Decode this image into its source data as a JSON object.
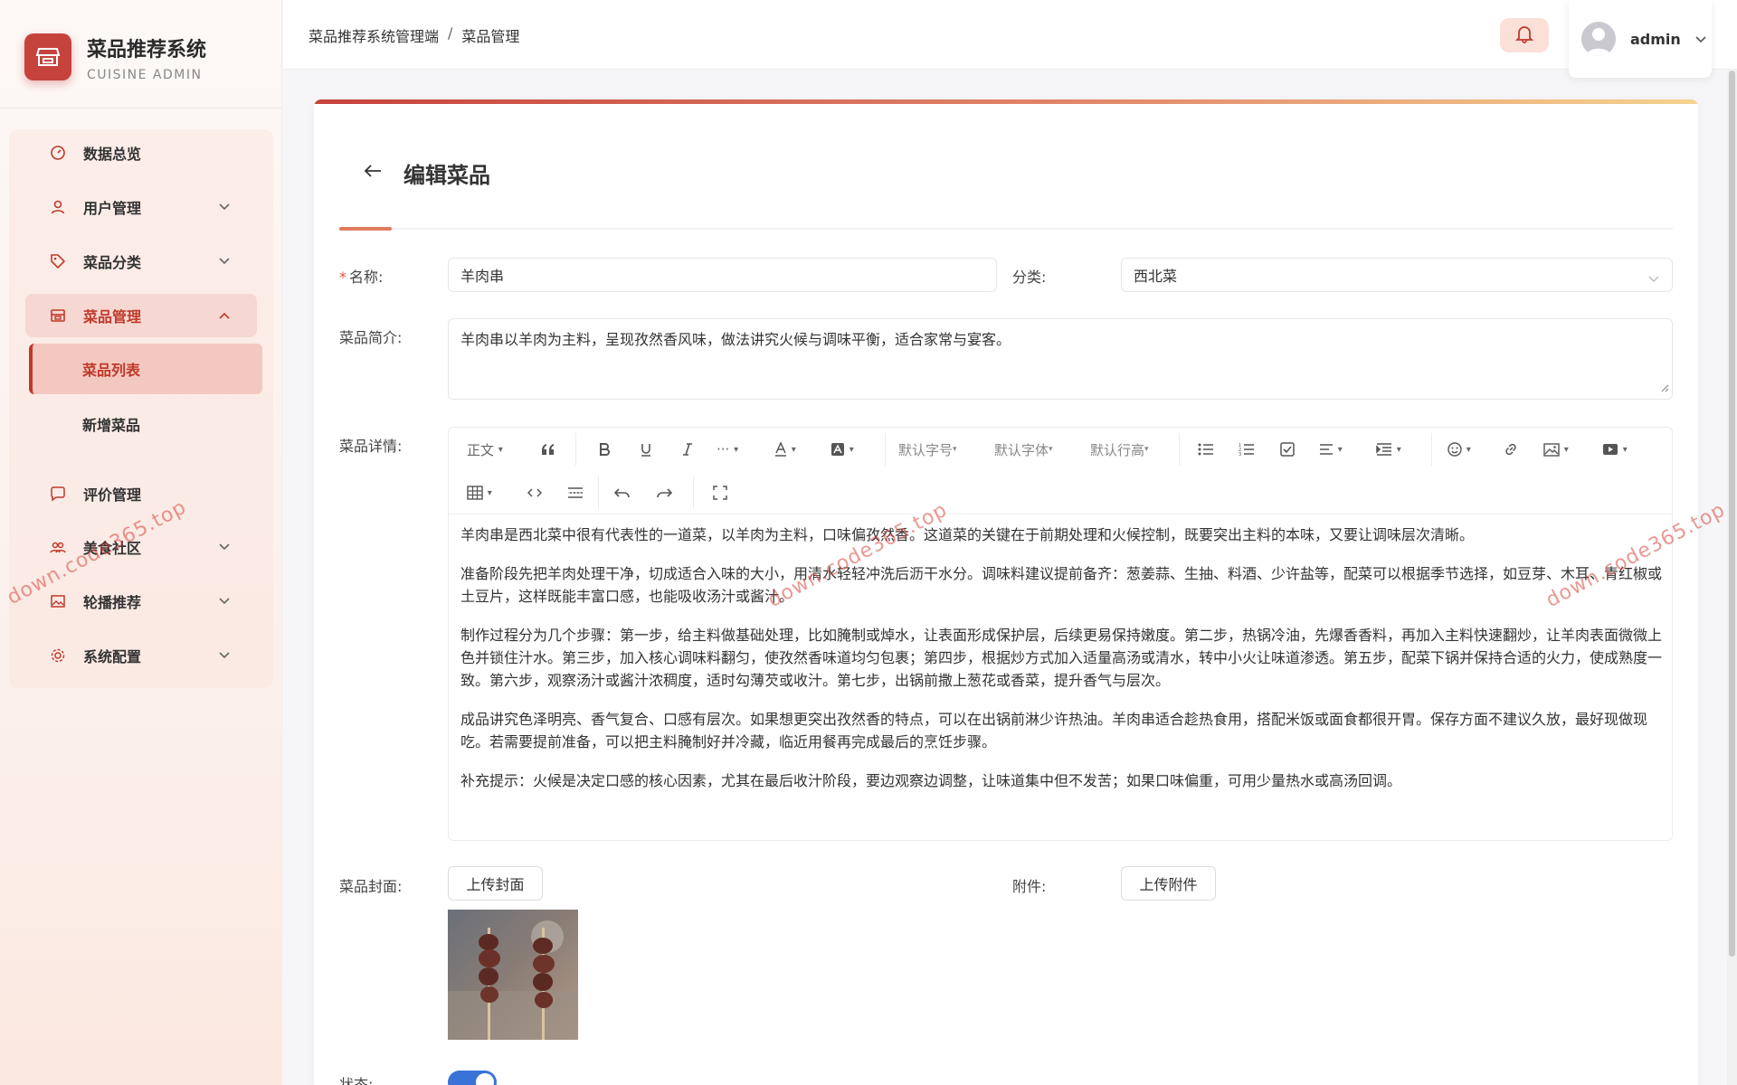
{
  "app": {
    "title": "菜品推荐系统",
    "subtitle": "CUISINE ADMIN"
  },
  "sidebar": {
    "items": [
      {
        "label": "数据总览",
        "icon": "dashboard-icon"
      },
      {
        "label": "用户管理",
        "icon": "user-icon",
        "expandable": true
      },
      {
        "label": "菜品分类",
        "icon": "tag-icon",
        "expandable": true
      },
      {
        "label": "菜品管理",
        "icon": "dish-icon",
        "expandable": true,
        "expanded": true,
        "active": true
      },
      {
        "label": "评价管理",
        "icon": "comment-icon"
      },
      {
        "label": "美食社区",
        "icon": "community-icon",
        "expandable": true
      },
      {
        "label": "轮播推荐",
        "icon": "image-icon",
        "expandable": true
      },
      {
        "label": "系统配置",
        "icon": "gear-icon",
        "expandable": true
      }
    ],
    "subitems": [
      {
        "label": "菜品列表",
        "selected": true
      },
      {
        "label": "新增菜品",
        "selected": false
      }
    ]
  },
  "header": {
    "breadcrumb": [
      "菜品推荐系统管理端",
      "菜品管理"
    ],
    "breadcrumb_sep": "/",
    "user": "admin"
  },
  "page": {
    "title": "编辑菜品"
  },
  "form": {
    "name_label": "名称:",
    "name_value": "羊肉串",
    "category_label": "分类:",
    "category_value": "西北菜",
    "intro_label": "菜品简介:",
    "intro_value": "羊肉串以羊肉为主料，呈现孜然香风味，做法讲究火候与调味平衡，适合家常与宴客。",
    "detail_label": "菜品详情:",
    "cover_label": "菜品封面:",
    "cover_button": "上传封面",
    "attachment_label": "附件:",
    "attachment_button": "上传附件",
    "status_label": "状态:",
    "status_on": true
  },
  "editor": {
    "toolbar": {
      "paragraph": "正文",
      "font_size": "默认字号",
      "font_family": "默认字体",
      "line_height": "默认行高"
    },
    "paragraphs": [
      "羊肉串是西北菜中很有代表性的一道菜，以羊肉为主料，口味偏孜然香。这道菜的关键在于前期处理和火候控制，既要突出主料的本味，又要让调味层次清晰。",
      "准备阶段先把羊肉处理干净，切成适合入味的大小，用清水轻轻冲洗后沥干水分。调味料建议提前备齐：葱姜蒜、生抽、料酒、少许盐等，配菜可以根据季节选择，如豆芽、木耳、青红椒或土豆片，这样既能丰富口感，也能吸收汤汁或酱汁。",
      "制作过程分为几个步骤：第一步，给主料做基础处理，比如腌制或焯水，让表面形成保护层，后续更易保持嫩度。第二步，热锅冷油，先爆香香料，再加入主料快速翻炒，让羊肉表面微微上色并锁住汁水。第三步，加入核心调味料翻匀，使孜然香味道均匀包裹；第四步，根据炒方式加入适量高汤或清水，转中小火让味道渗透。第五步，配菜下锅并保持合适的火力，使成熟度一致。第六步，观察汤汁或酱汁浓稠度，适时勾薄芡或收汁。第七步，出锅前撒上葱花或香菜，提升香气与层次。",
      "成品讲究色泽明亮、香气复合、口感有层次。如果想更突出孜然香的特点，可以在出锅前淋少许热油。羊肉串适合趁热食用，搭配米饭或面食都很开胃。保存方面不建议久放，最好现做现吃。若需要提前准备，可以把主料腌制好并冷藏，临近用餐再完成最后的烹饪步骤。",
      "补充提示：火候是决定口感的核心因素，尤其在最后收汁阶段，要边观察边调整，让味道集中但不发苦；如果口味偏重，可用少量热水或高汤回调。"
    ]
  },
  "watermark": "down.code365.top",
  "colors": {
    "accent": "#c0392b",
    "brand": "#c6423c",
    "toggle": "#3a73d8"
  }
}
